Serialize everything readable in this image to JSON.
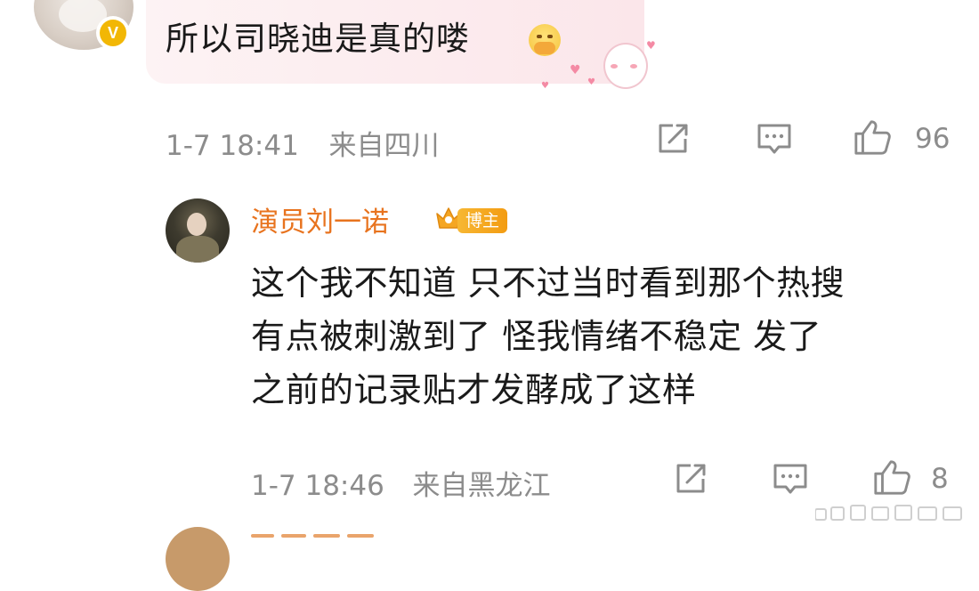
{
  "top_comment": {
    "text": "所以司晓迪是真的喽",
    "time": "1-7 18:41",
    "location": "来自四川",
    "likes": "96",
    "verified_badge": "V",
    "emoji": "pleading-face-emoji",
    "sticker": "sheep-sticker"
  },
  "reply": {
    "author": "演员刘一诺",
    "badge": "博主",
    "lines": [
      "这个我不知道 只不过当时看到那个热搜",
      "有点被刺激到了 怪我情绪不稳定 发了",
      "之前的记录贴才发酵成了这样"
    ],
    "time": "1-7 18:46",
    "location": "来自黑龙江",
    "likes": "8"
  },
  "icons": {
    "share": "share-icon",
    "comment": "comment-icon",
    "like": "thumbs-up-icon"
  },
  "colors": {
    "author": "#e8731e",
    "meta": "#8c8c8c",
    "badge": "#f39c12",
    "bubble": "#fbe6ea"
  }
}
